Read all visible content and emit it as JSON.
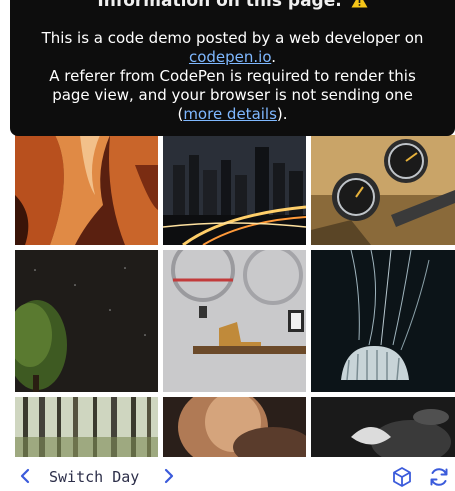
{
  "notice": {
    "heading": "Information on this page.",
    "line1": "This is a code demo posted by a web developer on",
    "link1": "codepen.io",
    "line1_tail": ".",
    "line2": "A referer from CodePen is required to render this",
    "line3": "page view, and your browser is not sending one",
    "line4_open": "(",
    "link2": "more details",
    "line4_close": ")."
  },
  "gallery": {
    "tiles": [
      {
        "label": "canyon"
      },
      {
        "label": "city-night"
      },
      {
        "label": "motorcycle-gauges"
      },
      {
        "label": "night-tree"
      },
      {
        "label": "wall-shelf-boot"
      },
      {
        "label": "jellyfish"
      },
      {
        "label": "forest"
      },
      {
        "label": "blurred-portrait"
      },
      {
        "label": "dark-abstract"
      }
    ]
  },
  "bottom_bar": {
    "switch_label": "Switch Day",
    "prev_icon": "chevron-left-icon",
    "next_icon": "chevron-right-icon",
    "tool_icon_1": "cube-icon",
    "tool_icon_2": "refresh-icon"
  },
  "colors": {
    "notice_bg": "#0d0d0d",
    "link": "#7fb8ff",
    "accent": "#3b5bdb",
    "label_text": "#2d2f4a"
  }
}
